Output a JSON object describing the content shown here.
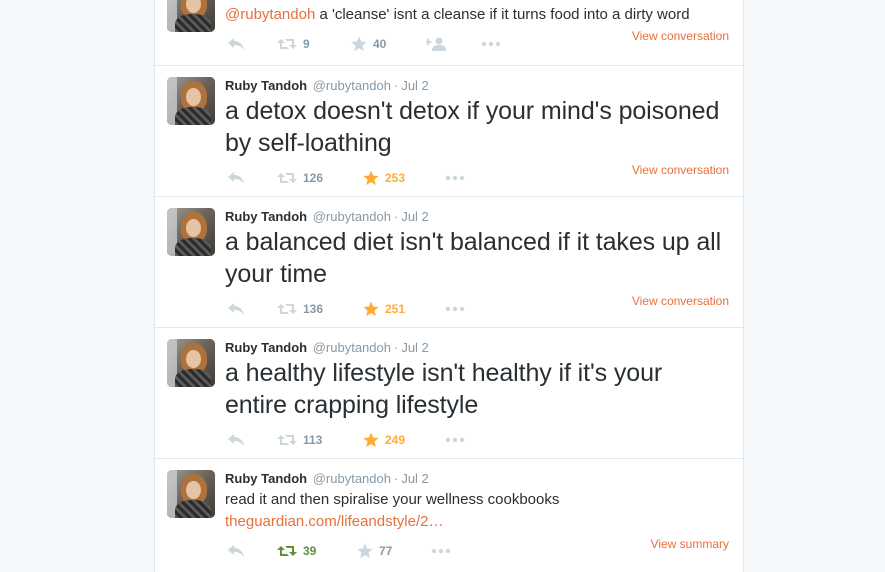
{
  "colors": {
    "accent": "#e8703a",
    "favorite_active": "#ffac33",
    "retweet_active": "#5c913b",
    "muted": "#8899a6"
  },
  "tweets": [
    {
      "mention": "@rubytandoh",
      "text": " a 'cleanse' isnt a cleanse if it turns food into a dirty word",
      "retweets": "9",
      "favorites": "40",
      "favorited": false,
      "retweeted": false,
      "footer_link": "View conversation",
      "follow_icon": "add-user-icon"
    },
    {
      "fullname": "Ruby Tandoh",
      "username": "@rubytandoh",
      "sep": "·",
      "time": "Jul 2",
      "text": "a detox doesn't detox if your mind's poisoned by self-loathing",
      "retweets": "126",
      "favorites": "253",
      "favorited": true,
      "retweeted": false,
      "footer_link": "View conversation"
    },
    {
      "fullname": "Ruby Tandoh",
      "username": "@rubytandoh",
      "sep": "·",
      "time": "Jul 2",
      "text": "a balanced diet isn't balanced if it takes up all your time",
      "retweets": "136",
      "favorites": "251",
      "favorited": true,
      "retweeted": false,
      "footer_link": "View conversation"
    },
    {
      "fullname": "Ruby Tandoh",
      "username": "@rubytandoh",
      "sep": "·",
      "time": "Jul 2",
      "text": "a healthy lifestyle isn't healthy if it's your entire crapping lifestyle",
      "retweets": "113",
      "favorites": "249",
      "favorited": true,
      "retweeted": false,
      "footer_link": ""
    },
    {
      "fullname": "Ruby Tandoh",
      "username": "@rubytandoh",
      "sep": "·",
      "time": "Jul 2",
      "text": "read it and then spiralise your wellness cookbooks",
      "link": "theguardian.com/lifeandstyle/2…",
      "retweets": "39",
      "favorites": "77",
      "favorited": false,
      "retweeted": true,
      "footer_link": "View summary"
    }
  ]
}
